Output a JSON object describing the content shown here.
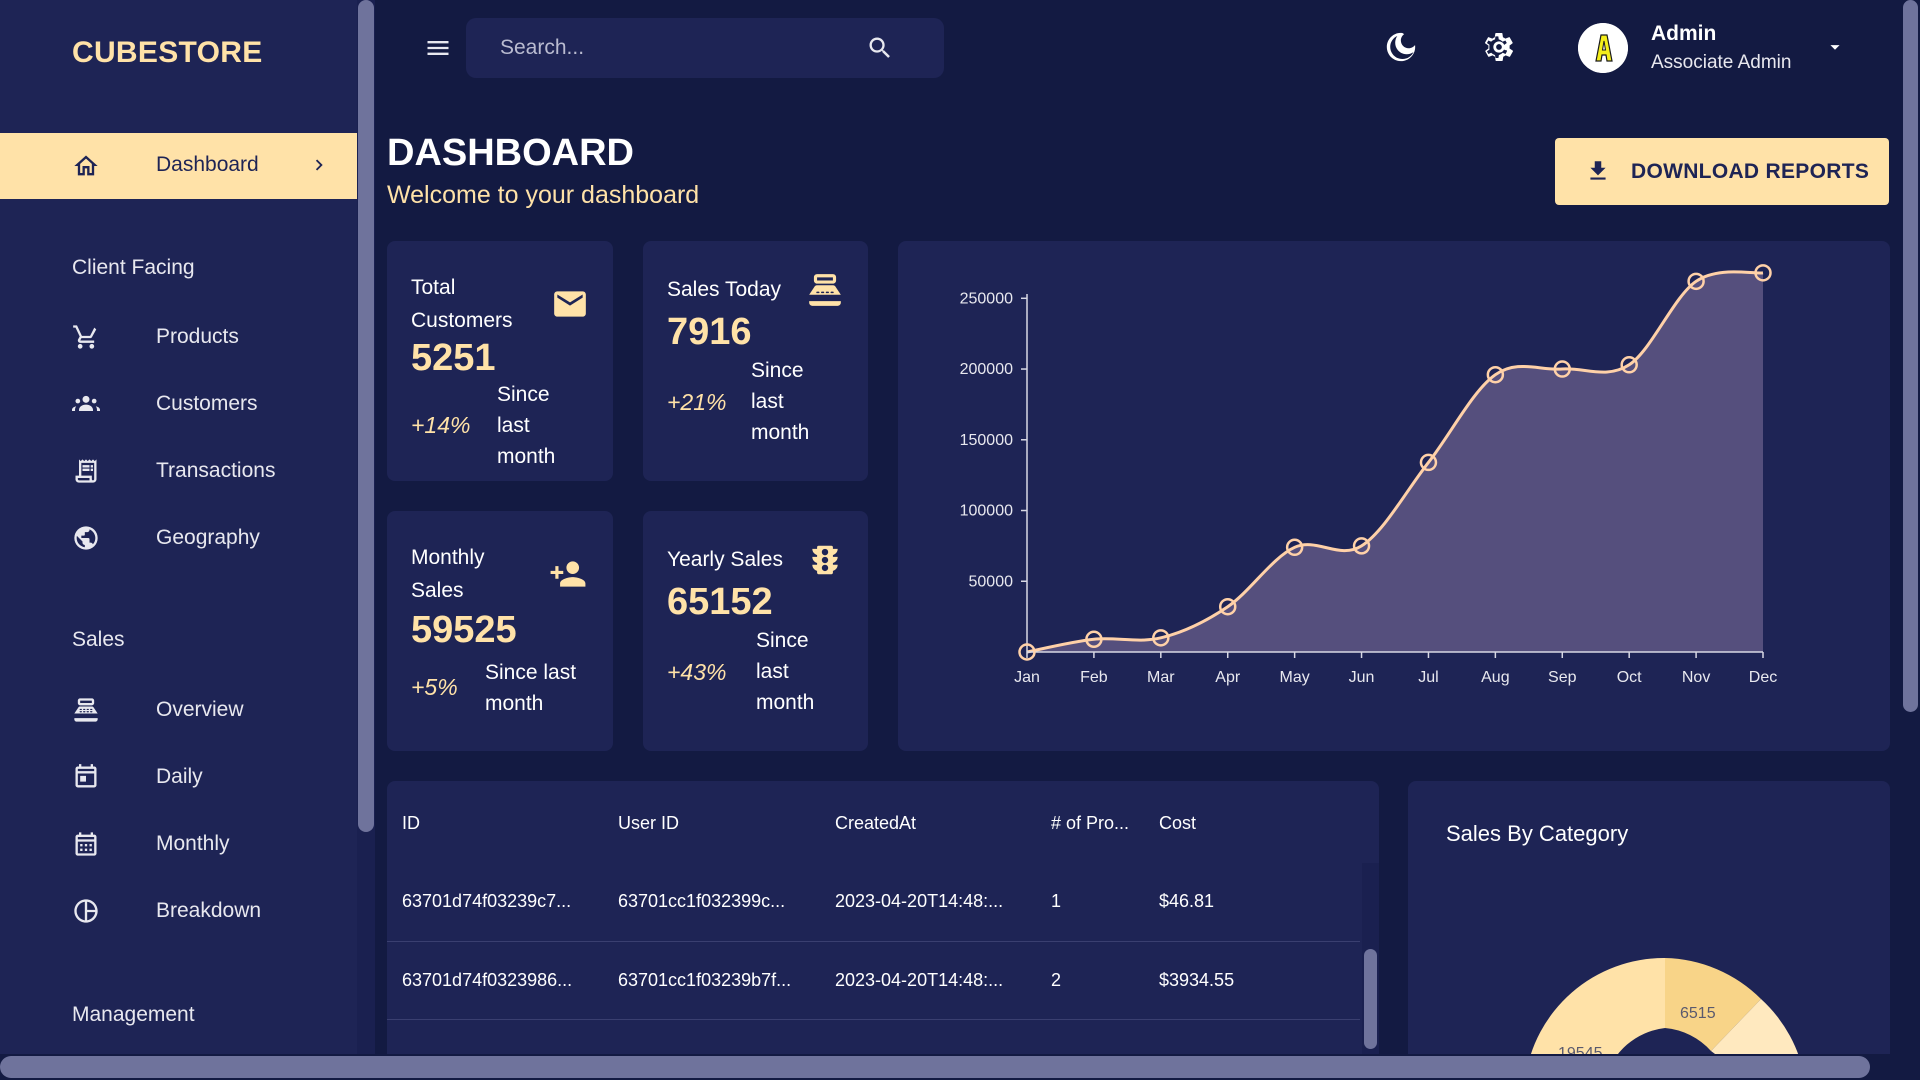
{
  "brand": "CUBESTORE",
  "colors": {
    "background": "#131a42",
    "panel": "#1e2455",
    "accent": "#ffe2a8",
    "text": "#ffffff",
    "chart_line": "#ffd1a8",
    "chart_fill": "#554f7d"
  },
  "sidebar": {
    "active": {
      "label": "Dashboard",
      "icon": "home-icon"
    },
    "sections": [
      {
        "title": "Client Facing",
        "items": [
          {
            "label": "Products",
            "icon": "shopping-cart-icon"
          },
          {
            "label": "Customers",
            "icon": "groups-icon"
          },
          {
            "label": "Transactions",
            "icon": "receipt-icon"
          },
          {
            "label": "Geography",
            "icon": "globe-icon"
          }
        ]
      },
      {
        "title": "Sales",
        "items": [
          {
            "label": "Overview",
            "icon": "point-of-sale-icon"
          },
          {
            "label": "Daily",
            "icon": "today-icon"
          },
          {
            "label": "Monthly",
            "icon": "calendar-month-icon"
          },
          {
            "label": "Breakdown",
            "icon": "pie-chart-icon"
          }
        ]
      },
      {
        "title": "Management",
        "items": []
      }
    ]
  },
  "topbar": {
    "search_placeholder": "Search...",
    "user": {
      "name": "Admin",
      "role": "Associate Admin",
      "avatar_letter": "A"
    }
  },
  "header": {
    "title": "DASHBOARD",
    "subtitle": "Welcome to your dashboard",
    "download_label": "DOWNLOAD REPORTS"
  },
  "stats": [
    {
      "title_lines": [
        "Total",
        "Customers"
      ],
      "value": "5251",
      "increase": "+14%",
      "since_lines": [
        "Since",
        "last",
        "month"
      ],
      "icon": "email-icon"
    },
    {
      "title_lines": [
        "Sales Today"
      ],
      "value": "7916",
      "increase": "+21%",
      "since_lines": [
        "Since",
        "last",
        "month"
      ],
      "icon": "point-of-sale-icon"
    },
    {
      "title_lines": [
        "Monthly",
        "Sales"
      ],
      "value": "59525",
      "increase": "+5%",
      "since_lines": [
        "Since last",
        "month"
      ],
      "icon": "person-add-icon"
    },
    {
      "title_lines": [
        "Yearly Sales"
      ],
      "value": "65152",
      "increase": "+43%",
      "since_lines": [
        "Since",
        "last",
        "month"
      ],
      "icon": "traffic-icon"
    }
  ],
  "chart_data": {
    "type": "area",
    "title": "",
    "xlabel": "",
    "ylabel": "",
    "categories": [
      "Jan",
      "Feb",
      "Mar",
      "Apr",
      "May",
      "Jun",
      "Jul",
      "Aug",
      "Sep",
      "Oct",
      "Nov",
      "Dec"
    ],
    "series": [
      {
        "values": [
          0,
          9000,
          10000,
          32000,
          74000,
          75000,
          134000,
          196000,
          200000,
          203000,
          262000,
          268000
        ]
      }
    ],
    "yticks": [
      50000,
      100000,
      150000,
      200000,
      250000
    ],
    "ylim": [
      0,
      270000
    ],
    "grid": false
  },
  "table": {
    "columns": [
      "ID",
      "User ID",
      "CreatedAt",
      "# of Pro...",
      "Cost"
    ],
    "rows": [
      [
        "63701d74f03239c7...",
        "63701cc1f032399c...",
        "2023-04-20T14:48:...",
        "1",
        "$46.81"
      ],
      [
        "63701d74f0323986...",
        "63701cc1f03239b7f...",
        "2023-04-20T14:48:...",
        "2",
        "$3934.55"
      ]
    ]
  },
  "category": {
    "title": "Sales By Category",
    "slices": [
      {
        "label": "19545",
        "value": 19545,
        "color": "#ffe2a8"
      },
      {
        "label": "6515",
        "value": 6515,
        "color": "#f8d488"
      }
    ]
  }
}
